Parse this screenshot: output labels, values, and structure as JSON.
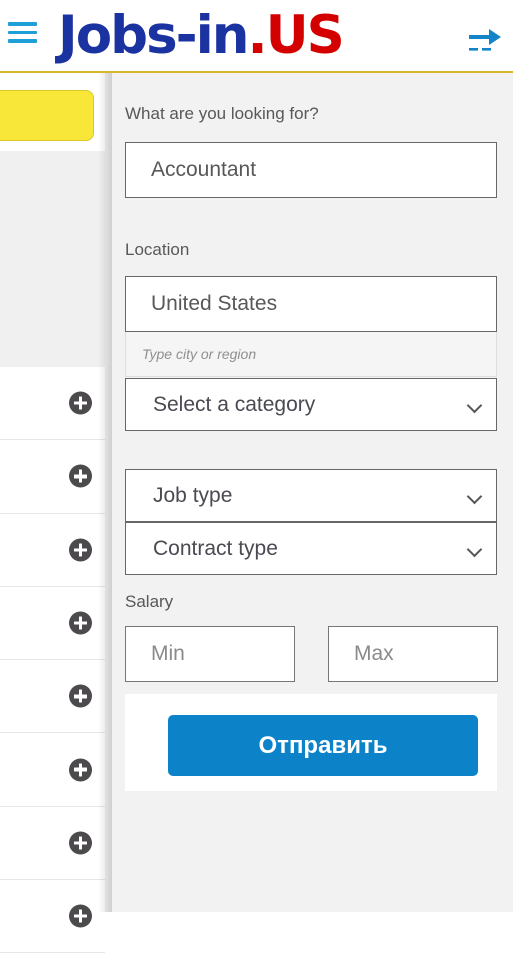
{
  "header": {
    "menu_icon": "hamburger-menu-icon",
    "brand_primary": "Jobs-in",
    "brand_secondary": ".US",
    "signin_icon": "sign-in-arrow-icon",
    "accent_blue": "#1f9fd8",
    "brand_blue": "#1b33a0",
    "brand_red": "#d40000",
    "underline_color": "#d9b72a"
  },
  "backdrop": {
    "promo_button_color": "#f8e739",
    "job_rows": [
      {
        "expand_icon": "plus-circle-icon"
      },
      {
        "expand_icon": "plus-circle-icon"
      },
      {
        "expand_icon": "plus-circle-icon"
      },
      {
        "expand_icon": "plus-circle-icon"
      },
      {
        "expand_icon": "plus-circle-icon"
      },
      {
        "expand_icon": "plus-circle-icon"
      },
      {
        "expand_icon": "plus-circle-icon"
      },
      {
        "expand_icon": "plus-circle-icon"
      }
    ]
  },
  "search_form": {
    "keyword_label": "What are you looking for?",
    "keyword_value": "Accountant",
    "location_label": "Location",
    "country_value": "United States",
    "city_placeholder": "Type city or region",
    "city_value": "",
    "category_value": "Select a category",
    "job_type_value": "Job type",
    "contract_type_value": "Contract type",
    "salary_label": "Salary",
    "salary_min_placeholder": "Min",
    "salary_max_placeholder": "Max",
    "submit_label": "Отправить",
    "submit_color": "#0c83c9",
    "chevron_icon": "chevron-down-icon"
  }
}
